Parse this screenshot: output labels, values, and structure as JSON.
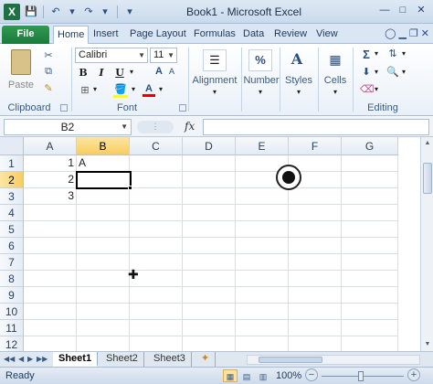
{
  "window": {
    "title": "Book1 - Microsoft Excel",
    "app_icon": "X",
    "buttons": [
      "—",
      "□",
      "✕"
    ]
  },
  "qat": {
    "save": "💾",
    "undo": "↶",
    "redo": "↷",
    "more": "▾"
  },
  "tabs": {
    "file": "File",
    "home": "Home",
    "insert": "Insert",
    "page_layout": "Page Layout",
    "formulas": "Formulas",
    "data": "Data",
    "review": "Review",
    "view": "View"
  },
  "ribbon": {
    "clipboard": {
      "label": "Clipboard",
      "paste": "Paste"
    },
    "font": {
      "label": "Font",
      "name": "Calibri",
      "size": "11",
      "bold": "B",
      "italic": "I",
      "underline": "U",
      "font_color_letter": "A"
    },
    "alignment": {
      "label": "Alignment"
    },
    "number": {
      "label": "Number",
      "icon": "%"
    },
    "styles": {
      "label": "Styles"
    },
    "cells": {
      "label": "Cells"
    },
    "editing": {
      "label": "Editing",
      "sum": "Σ"
    }
  },
  "formula_bar": {
    "name_box": "B2",
    "fx": "fx",
    "formula": ""
  },
  "columns": [
    "A",
    "B",
    "C",
    "D",
    "E",
    "F",
    "G"
  ],
  "rows": [
    "1",
    "2",
    "3",
    "4",
    "5",
    "6",
    "7",
    "8",
    "9",
    "10",
    "11",
    "12"
  ],
  "cells": {
    "A1": "1",
    "B1": "A",
    "A2": "2",
    "A3": "3"
  },
  "active_cell": "B2",
  "sheets": [
    "Sheet1",
    "Sheet2",
    "Sheet3"
  ],
  "active_sheet": "Sheet1",
  "status": {
    "text": "Ready",
    "zoom": "100%"
  },
  "colors": {
    "file_tab": "#1d7a3b",
    "selected_header": "#f9cc5d",
    "ribbon_label": "#3b5b85"
  }
}
